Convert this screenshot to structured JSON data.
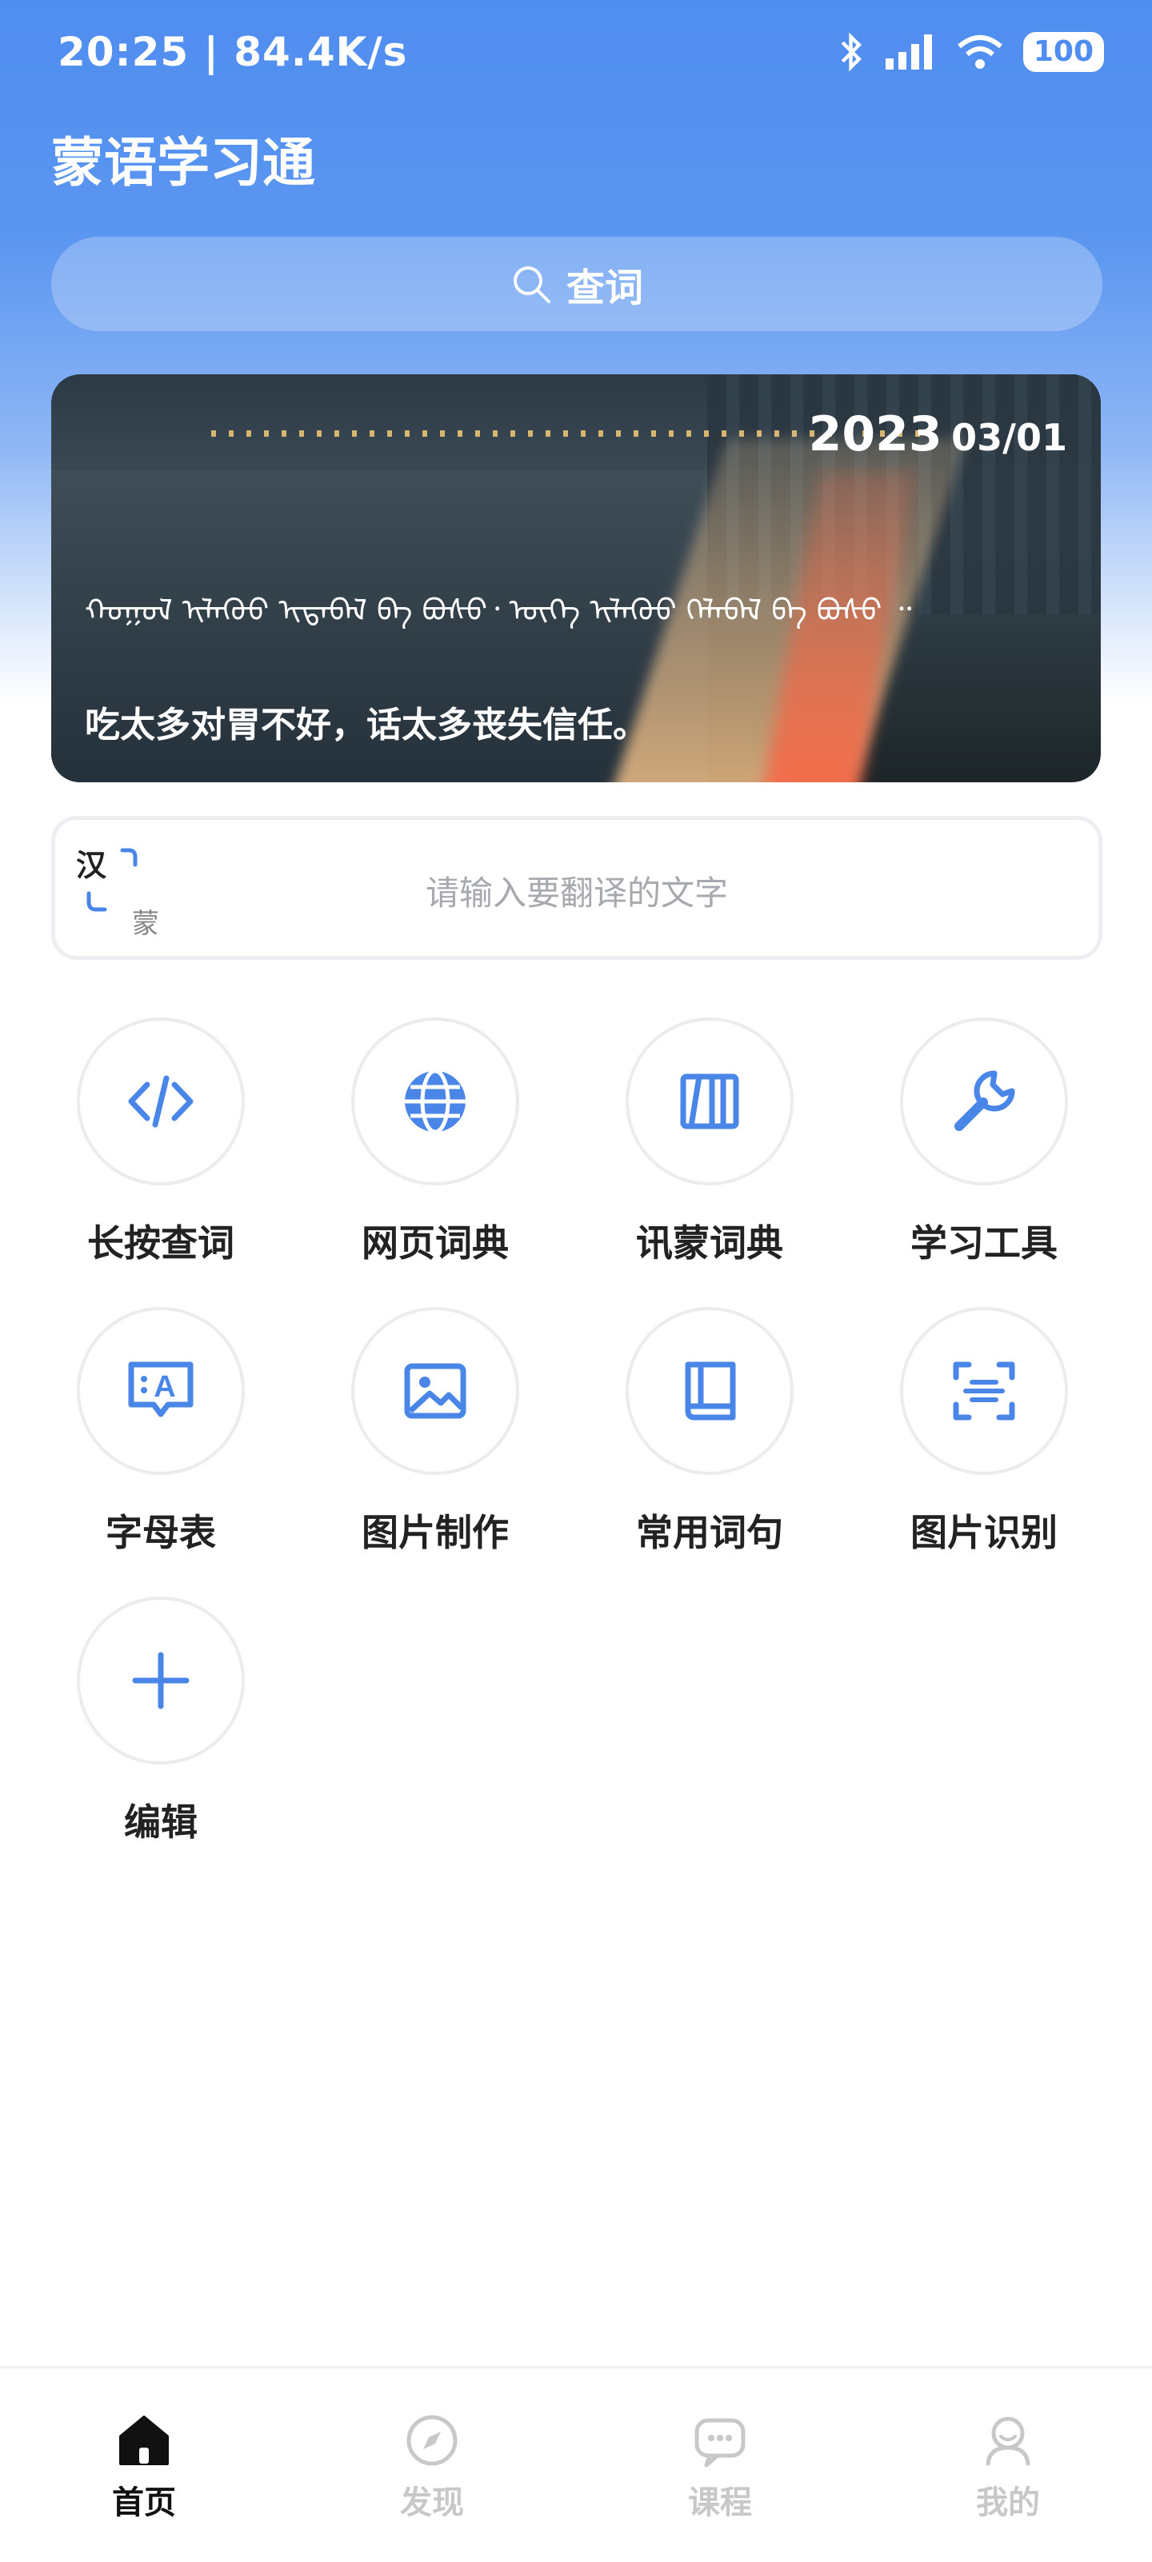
{
  "status_bar": {
    "time": "20:25",
    "speed": "84.4K/s",
    "battery": "100"
  },
  "header": {
    "title": "蒙语学习通"
  },
  "search": {
    "label": "查词"
  },
  "banner": {
    "year": "2023",
    "date": "03/01",
    "mongolian_text": "ᠬᠣᠭᠣᠯ ᠢᠯᠡᠭᠦᠦ ᠢᠳᠡᠪᠡᠯ ᠪᠡ ᠪᠤᠰᠤ᠂ ᠦᠭᠡ ᠢᠯᠡᠭᠦᠦ ᠬᠡᠯᠡᠪᠡᠯ ᠪᠡ ᠪᠤᠰᠤ ᠃",
    "chinese_quote": "吃太多对胃不好，话太多丧失信任。"
  },
  "translate": {
    "source_lang": "汉",
    "target_lang": "蒙",
    "placeholder": "请输入要翻译的文字"
  },
  "features": [
    {
      "label": "长按查词",
      "icon": "code-icon"
    },
    {
      "label": "网页词典",
      "icon": "globe-icon"
    },
    {
      "label": "讯蒙词典",
      "icon": "books-icon"
    },
    {
      "label": "学习工具",
      "icon": "wrench-icon"
    },
    {
      "label": "字母表",
      "icon": "alphabet-icon"
    },
    {
      "label": "图片制作",
      "icon": "image-icon"
    },
    {
      "label": "常用词句",
      "icon": "book-icon"
    },
    {
      "label": "图片识别",
      "icon": "scan-icon"
    },
    {
      "label": "编辑",
      "icon": "plus-icon"
    }
  ],
  "tabs": [
    {
      "label": "首页",
      "icon": "home-icon",
      "active": true
    },
    {
      "label": "发现",
      "icon": "compass-icon",
      "active": false
    },
    {
      "label": "课程",
      "icon": "chat-icon",
      "active": false
    },
    {
      "label": "我的",
      "icon": "user-icon",
      "active": false
    }
  ],
  "colors": {
    "accent": "#4f8df0",
    "icon_blue": "#4a86e8",
    "inactive": "#c8c8c8"
  }
}
